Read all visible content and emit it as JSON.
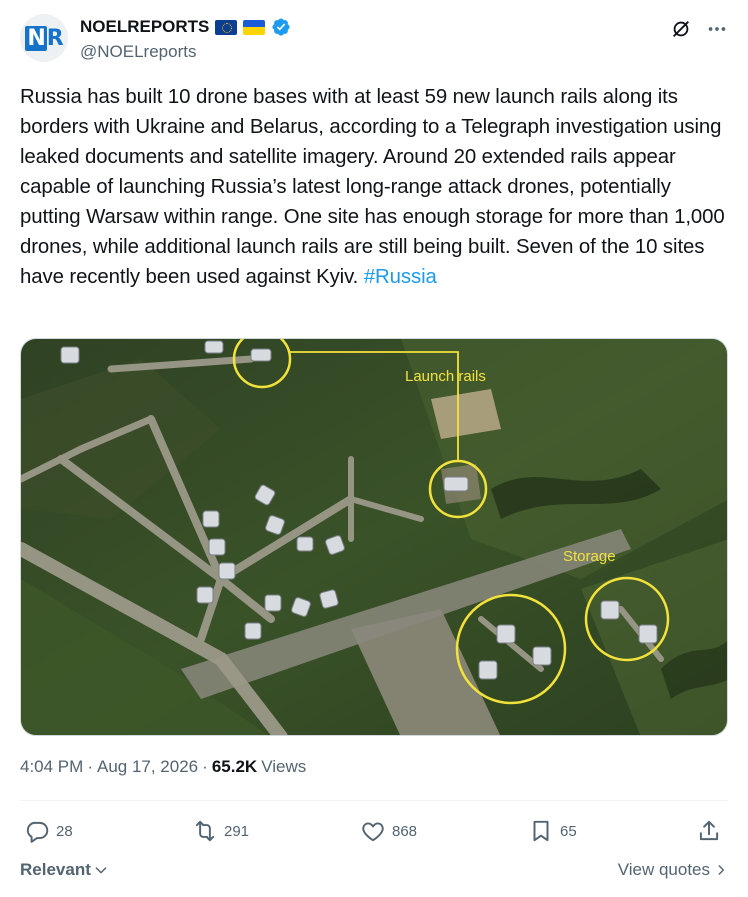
{
  "author": {
    "avatar_text_n": "N",
    "avatar_text_r": "R",
    "name": "NOELREPORTS",
    "handle": "@NOELreports"
  },
  "tweet": {
    "text": "Russia has built 10 drone bases with at least 59 new launch rails along its borders with Ukraine and Belarus, according to a Telegraph investigation using leaked documents and satellite imagery. Around 20 extended rails appear capable of launching Russia’s latest long-range attack drones, potentially putting Warsaw within range. One site has enough storage for more than 1,000 drones, while additional launch rails are still being built. Seven of the 10 sites have recently been used against Kyiv. ",
    "hashtag": "#Russia"
  },
  "media": {
    "label_launch": "Launch rails",
    "label_storage": "Storage"
  },
  "meta": {
    "time": "4:04 PM",
    "sep1": "·",
    "date": "Aug 17, 2026",
    "sep2": "·",
    "views_count": "65.2K",
    "views_label": "Views"
  },
  "actions": {
    "replies": "28",
    "reposts": "291",
    "likes": "868",
    "bookmarks": "65"
  },
  "footer": {
    "sort_label": "Relevant",
    "view_quotes": "View quotes"
  },
  "colors": {
    "accent": "#1d9bf0",
    "verified": "#1d9bf0",
    "muted": "#536471",
    "annotation_yellow": "#f3e23b"
  },
  "icons": [
    "verified-badge-icon",
    "grok-icon",
    "more-icon",
    "reply-icon",
    "repost-icon",
    "like-icon",
    "bookmark-icon",
    "share-icon",
    "chevron-down-icon",
    "chevron-right-icon"
  ]
}
